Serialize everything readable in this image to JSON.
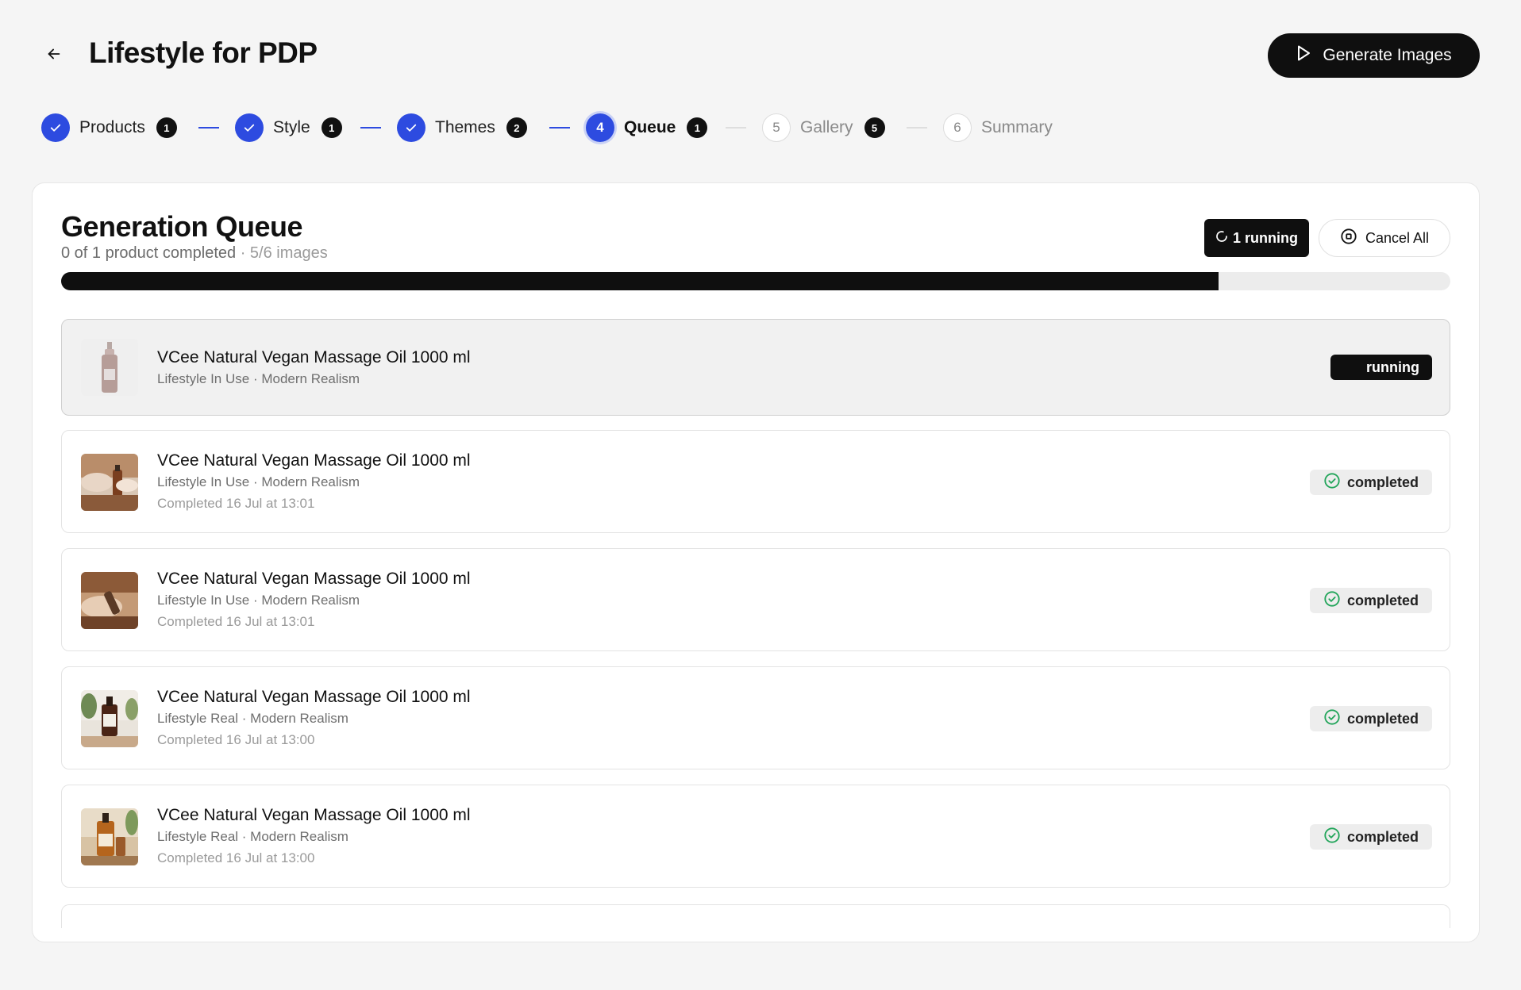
{
  "header": {
    "title": "Lifestyle for PDP",
    "generate_label": "Generate Images"
  },
  "stepper": [
    {
      "label": "Products",
      "count": "1",
      "state": "done",
      "number": ""
    },
    {
      "label": "Style",
      "count": "1",
      "state": "done",
      "number": ""
    },
    {
      "label": "Themes",
      "count": "2",
      "state": "done",
      "number": ""
    },
    {
      "label": "Queue",
      "count": "1",
      "state": "active",
      "number": "4"
    },
    {
      "label": "Gallery",
      "count": "5",
      "state": "pending",
      "number": "5"
    },
    {
      "label": "Summary",
      "count": "",
      "state": "pending",
      "number": "6"
    }
  ],
  "queue": {
    "title": "Generation Queue",
    "subtitle_main": "0 of 1 product completed",
    "subtitle_images": " · 5/6 images",
    "running_label": "1 running",
    "cancel_label": "Cancel All",
    "progress_fraction": 0.833,
    "items": [
      {
        "name": "VCee Natural Vegan Massage Oil 1000 ml",
        "meta": "Lifestyle In Use · Modern Realism",
        "time": "",
        "status": "running"
      },
      {
        "name": "VCee Natural Vegan Massage Oil 1000 ml",
        "meta": "Lifestyle In Use · Modern Realism",
        "time": "Completed 16 Jul at 13:01",
        "status": "completed"
      },
      {
        "name": "VCee Natural Vegan Massage Oil 1000 ml",
        "meta": "Lifestyle In Use · Modern Realism",
        "time": "Completed 16 Jul at 13:01",
        "status": "completed"
      },
      {
        "name": "VCee Natural Vegan Massage Oil 1000 ml",
        "meta": "Lifestyle Real · Modern Realism",
        "time": "Completed 16 Jul at 13:00",
        "status": "completed"
      },
      {
        "name": "VCee Natural Vegan Massage Oil 1000 ml",
        "meta": "Lifestyle Real · Modern Realism",
        "time": "Completed 16 Jul at 13:00",
        "status": "completed"
      }
    ]
  },
  "colors": {
    "accent": "#2d4be0",
    "dark": "#0f0f0f",
    "success": "#22a55a"
  },
  "icons": {
    "back": "arrow-left-icon",
    "generate": "play-icon",
    "running": "spinner-icon",
    "cancel": "stop-circle-icon",
    "completed": "check-circle-icon",
    "step_done": "check-icon"
  }
}
